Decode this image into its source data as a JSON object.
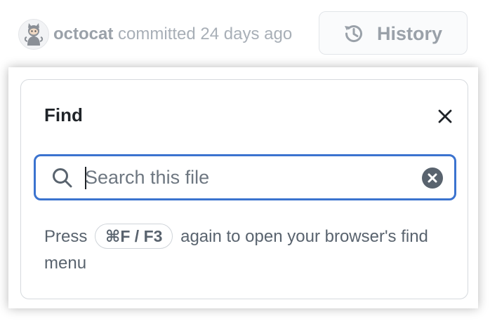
{
  "commit": {
    "author": "octocat",
    "action": "committed",
    "time": "24 days ago"
  },
  "history_button": {
    "label": "History",
    "icon": "history-icon"
  },
  "find_dialog": {
    "title": "Find",
    "close_icon": "close-icon",
    "search": {
      "placeholder": "Search this file",
      "value": "",
      "icon": "search-icon",
      "clear_icon": "clear-icon"
    },
    "hint": {
      "before": "Press",
      "shortcut": "⌘F / F3",
      "after": "again to open your browser's find menu"
    }
  },
  "colors": {
    "focus_border": "#3b73cf",
    "text_primary": "#1f2328",
    "text_muted": "#59636e"
  }
}
